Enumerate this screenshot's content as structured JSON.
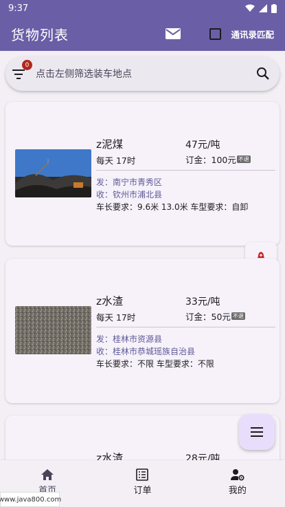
{
  "status_bar": {
    "time": "9:37"
  },
  "app_bar": {
    "title": "货物列表",
    "contact_match_label": "通讯录匹配",
    "contact_match_checked": false
  },
  "search": {
    "badge_count": "0",
    "placeholder": "点击左侧筛选装车地点"
  },
  "cargo_items": [
    {
      "goods": "z泥煤",
      "time": "每天 17时",
      "price": "47元/吨",
      "deposit": "订金：100元",
      "deposit_tag": "不退",
      "from": "发：南宁市青秀区",
      "to": "收：钦州市浦北县",
      "requirement": "车长要求：9.6米 13.0米 车型要求：自卸"
    },
    {
      "goods": "z水渣",
      "time": "每天 17时",
      "price": "33元/吨",
      "deposit": "订金：50元",
      "deposit_tag": "不退",
      "from": "发：桂林市资源县",
      "to": "收：桂林市恭城瑶族自治县",
      "requirement": "车长要求：不限 车型要求：不限"
    },
    {
      "goods": "z水渣",
      "price": "28元/吨"
    }
  ],
  "bottom_nav": [
    {
      "label": "首页",
      "icon": "home-icon",
      "active": true
    },
    {
      "label": "订单",
      "icon": "list-icon",
      "active": false
    },
    {
      "label": "我的",
      "icon": "user-settings-icon",
      "active": false
    }
  ],
  "watermark": "www.java800.com",
  "colors": {
    "primary": "#6a5fa6",
    "badge": "#b3261e",
    "address": "#5f5a96",
    "fab_bg": "#e8defc"
  }
}
